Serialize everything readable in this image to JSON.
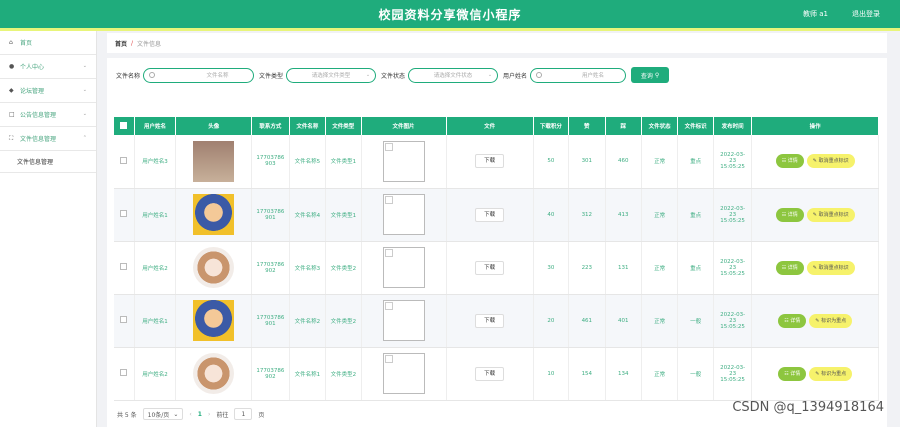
{
  "header": {
    "title": "校园资料分享微信小程序",
    "user": "教师 a1",
    "logout": "退出登录"
  },
  "sidebar": {
    "items": [
      {
        "label": "首页",
        "icon": "home-icon"
      },
      {
        "label": "个人中心",
        "icon": "person-icon"
      },
      {
        "label": "论坛管理",
        "icon": "pin-icon"
      },
      {
        "label": "公告信息管理",
        "icon": "doc-icon"
      },
      {
        "label": "文件信息管理",
        "icon": "expand-icon"
      }
    ],
    "sub": "文件信息管理"
  },
  "breadcrumb": {
    "home": "首页",
    "sep": "/",
    "current": "文件信息"
  },
  "search": {
    "l1": "文件名称",
    "p1": "文件名称",
    "l2": "文件类型",
    "p2": "请选择文件类型",
    "l3": "文件状态",
    "p3": "请选择文件状态",
    "l4": "用户姓名",
    "p4": "用户姓名",
    "btn": "查询"
  },
  "table": {
    "headers": [
      "用户姓名",
      "头像",
      "联系方式",
      "文件名称",
      "文件类型",
      "文件图片",
      "文件",
      "下载积分",
      "赞",
      "踩",
      "文件状态",
      "文件标识",
      "发布时间",
      "操作"
    ],
    "rows": [
      {
        "name": "用户姓名3",
        "phone": "17703786903",
        "fname": "文件名称5",
        "ftype": "文件类型1",
        "dl": "下载",
        "points": "50",
        "like": "301",
        "dislike": "460",
        "status": "正常",
        "tag": "重点",
        "time": "2022-03-23 15:05:25",
        "detail": "详情",
        "op": "取消重点标识"
      },
      {
        "name": "用户姓名1",
        "phone": "17703786901",
        "fname": "文件名称4",
        "ftype": "文件类型1",
        "dl": "下载",
        "points": "40",
        "like": "312",
        "dislike": "413",
        "status": "正常",
        "tag": "重点",
        "time": "2022-03-23 15:05:25",
        "detail": "详情",
        "op": "取消重点标识"
      },
      {
        "name": "用户姓名2",
        "phone": "17703786902",
        "fname": "文件名称3",
        "ftype": "文件类型2",
        "dl": "下载",
        "points": "30",
        "like": "223",
        "dislike": "131",
        "status": "正常",
        "tag": "重点",
        "time": "2022-03-23 15:05:25",
        "detail": "详情",
        "op": "取消重点标识"
      },
      {
        "name": "用户姓名1",
        "phone": "17703786901",
        "fname": "文件名称2",
        "ftype": "文件类型2",
        "dl": "下载",
        "points": "20",
        "like": "461",
        "dislike": "401",
        "status": "正常",
        "tag": "一般",
        "time": "2022-03-23 15:05:25",
        "detail": "详情",
        "op": "标识为重点"
      },
      {
        "name": "用户姓名2",
        "phone": "17703786902",
        "fname": "文件名称1",
        "ftype": "文件类型2",
        "dl": "下载",
        "points": "10",
        "like": "154",
        "dislike": "134",
        "status": "正常",
        "tag": "一般",
        "time": "2022-03-23 15:05:25",
        "detail": "详情",
        "op": "标识为重点"
      }
    ]
  },
  "pager": {
    "total": "共 5 条",
    "size": "10条/页",
    "page": "1",
    "goto": "前往",
    "jumpval": "1",
    "unit": "页"
  },
  "watermark": "CSDN @q_1394918164"
}
